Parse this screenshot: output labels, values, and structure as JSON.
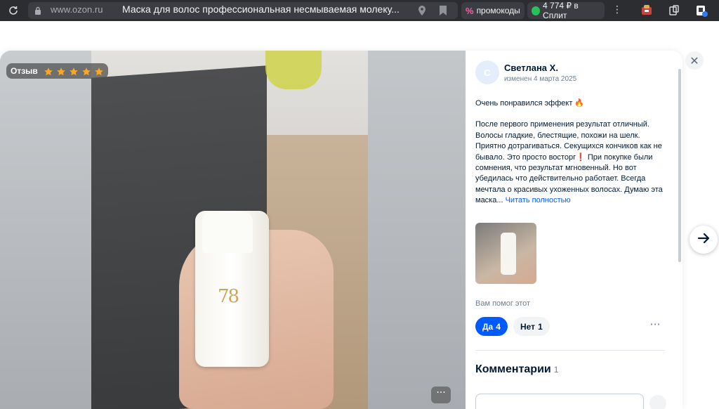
{
  "browser": {
    "url": "www.ozon.ru",
    "tab_title": "Маска для волос профессиональная несмываемая молеку...",
    "promo_label": "промокоды",
    "promo_icon": "%",
    "split_label": "4 774 ₽ в Сплит",
    "kebab": "⋮"
  },
  "photo": {
    "badge_label": "Отзыв",
    "rating": 5,
    "bottle_mark": "78",
    "more": "···"
  },
  "review": {
    "avatar_letter": "С",
    "author": "Светлана Х.",
    "edited": "изменен 4 марта 2025",
    "headline": "Очень понравился эффект 🔥",
    "body": "После первого применения результат отличный. Волосы гладкие, блестящие, похожи на шелк. Приятно дотрагиваться. Секущихся кончиков как не бывало. Это просто восторг❗ При покупке были сомнения, что результат мгновенный. Но вот убедилась что действительно работает. Всегда мечтала о красивых ухоженных волосах. Думаю эта маска...",
    "read_more": "Читать полностью",
    "helpful_label": "Вам помог этот",
    "yes_label": "Да",
    "yes_count": "4",
    "no_label": "Нет",
    "no_count": "1",
    "more": "···"
  },
  "comments": {
    "title": "Комментарии",
    "count": "1"
  },
  "controls": {
    "close": "✕"
  },
  "colors": {
    "accent": "#005bff",
    "star": "#f9a825",
    "text": "#001a34",
    "muted": "#707f8d"
  }
}
